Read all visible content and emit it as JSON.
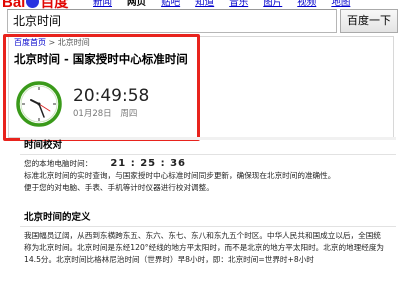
{
  "logo": {
    "text_a": "Bai",
    "text_b": "du",
    "text_c": "百度"
  },
  "nav": {
    "items": [
      "新闻",
      "网页",
      "贴吧",
      "知道",
      "音乐",
      "图片",
      "视频",
      "地图"
    ],
    "active_index": 1
  },
  "search": {
    "value": "北京时间",
    "button_label": "百度一下"
  },
  "card": {
    "breadcrumb_home": "百度首页",
    "breadcrumb_sep": ">",
    "breadcrumb_current": "北京时间",
    "title": "北京时间 - 国家授时中心标准时间",
    "time": "20:49:58",
    "date": "01月28日",
    "weekday": "周四"
  },
  "calibration": {
    "heading": "时间校对",
    "local_label": "您的本地电脑时间：",
    "local_time": "21 : 25 : 36",
    "line2": "标准北京时间的实时查询，与国家授时中心标准时间同步更新，确保现在北京时间的准确性。",
    "line3": "便于您的对电脑、手表、手机等计时仪器进行校对调整。"
  },
  "definition": {
    "heading": "北京时间的定义",
    "line1": "我国幅员辽阔，从西到东横跨东五、东六、东七、东八和东九五个时区。中华人民共和国成立以后，全国统",
    "line2": "称为北京时间。北京时间是东经120°经线的地方平太阳时，而不是北京的地方平太阳时。北京的地理经度为",
    "line3": "14.5分。北京时间比格林尼治时间（世界时）早8小时，即：北京时间=世界时+8小时"
  },
  "colors": {
    "highlight": "#e8231d",
    "link": "#0000cc",
    "clock_ring": "#3a9a1a"
  }
}
